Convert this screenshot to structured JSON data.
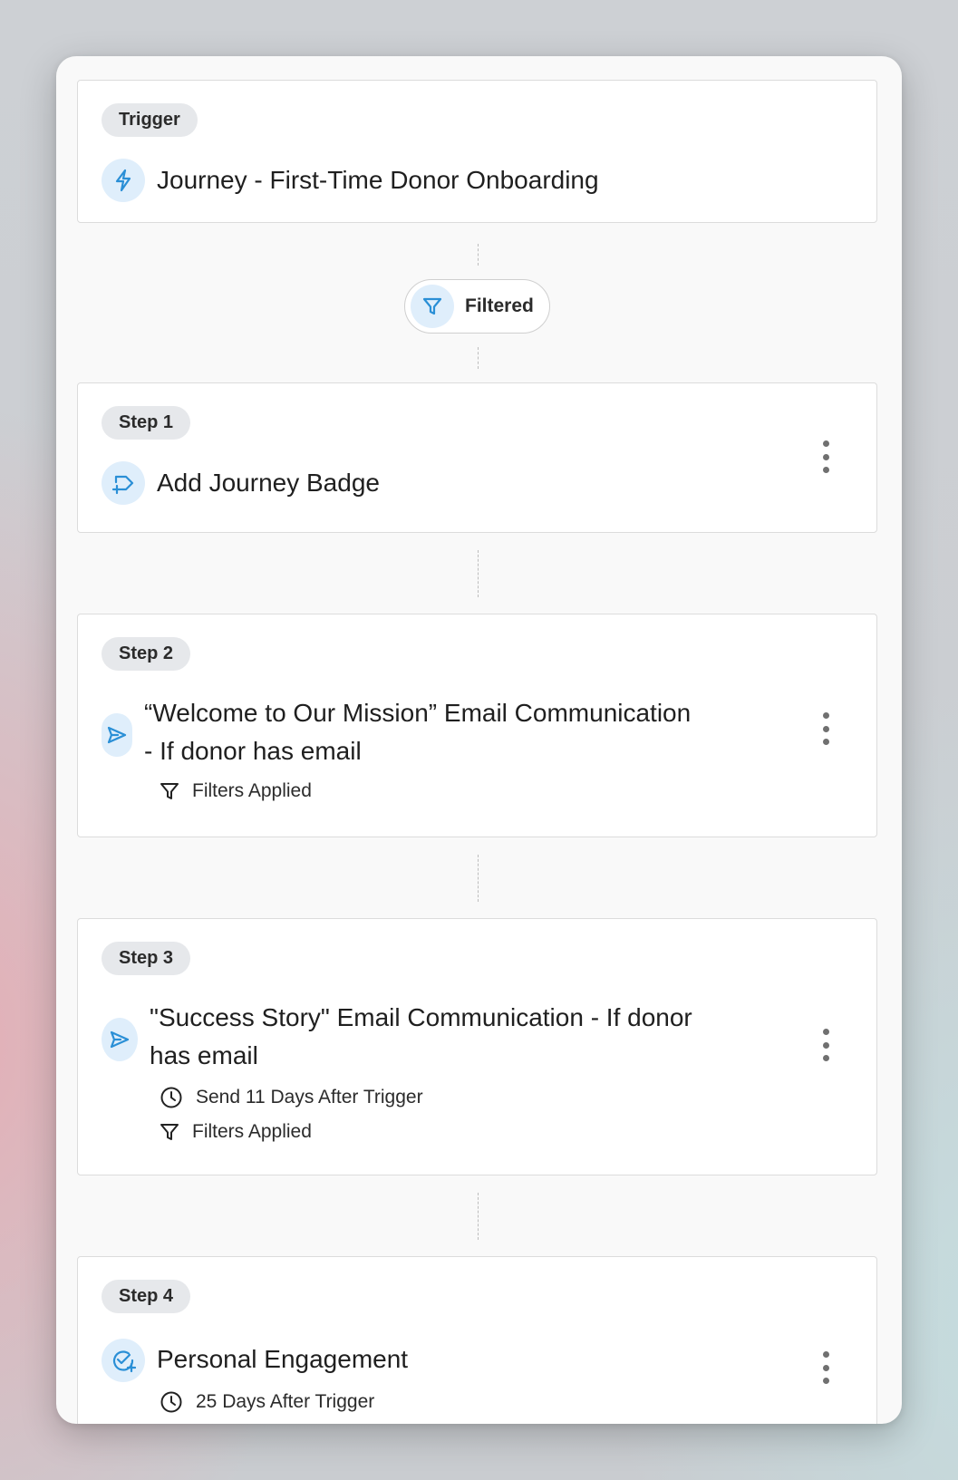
{
  "trigger": {
    "badge": "Trigger",
    "title": "Journey - First-Time Donor Onboarding",
    "icon": "lightning-bolt-icon"
  },
  "filter_chip": {
    "label": "Filtered",
    "icon": "filter-icon"
  },
  "steps": [
    {
      "badge": "Step 1",
      "title": "Add Journey Badge",
      "icon": "badge-add-icon"
    },
    {
      "badge": "Step 2",
      "title_line1": "“Welcome to Our Mission” Email Communication",
      "title_line2": "- If donor has email",
      "icon": "send-icon",
      "filters": "Filters Applied"
    },
    {
      "badge": "Step 3",
      "title_line1": "\"Success Story\" Email Communication - If donor",
      "title_line2": "has email",
      "icon": "send-icon",
      "schedule": "Send 11 Days After Trigger",
      "filters": "Filters Applied"
    },
    {
      "badge": "Step 4",
      "title": "Personal Engagement",
      "icon": "task-check-icon",
      "schedule": "25 Days After Trigger"
    }
  ],
  "colors": {
    "accent": "#2a8fd6",
    "icon_bg": "#dfeefb",
    "pill_bg": "#e6e8eb"
  }
}
